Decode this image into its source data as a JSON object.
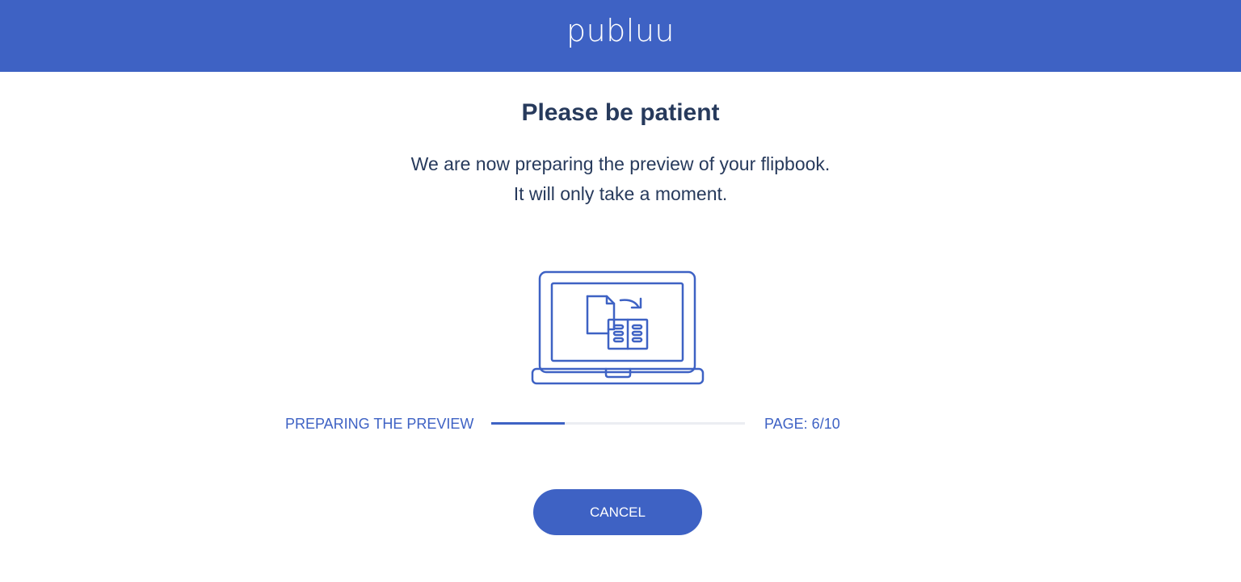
{
  "header": {
    "logo_text": "publuu",
    "background_color": "#3e62c4"
  },
  "main": {
    "title": "Please be patient",
    "subtitle_line1": "We are now preparing the preview of your flipbook.",
    "subtitle_line2": "It will only take a moment.",
    "illustration_icon": "laptop-flipbook-conversion-icon"
  },
  "progress": {
    "label": "PREPARING THE PREVIEW",
    "page_text": "PAGE: 6/10",
    "current_page": 6,
    "total_pages": 10,
    "fill_fraction": 0.29,
    "color": "#3e62c4",
    "track_color": "#ebedf2"
  },
  "actions": {
    "cancel_label": "CANCEL"
  }
}
